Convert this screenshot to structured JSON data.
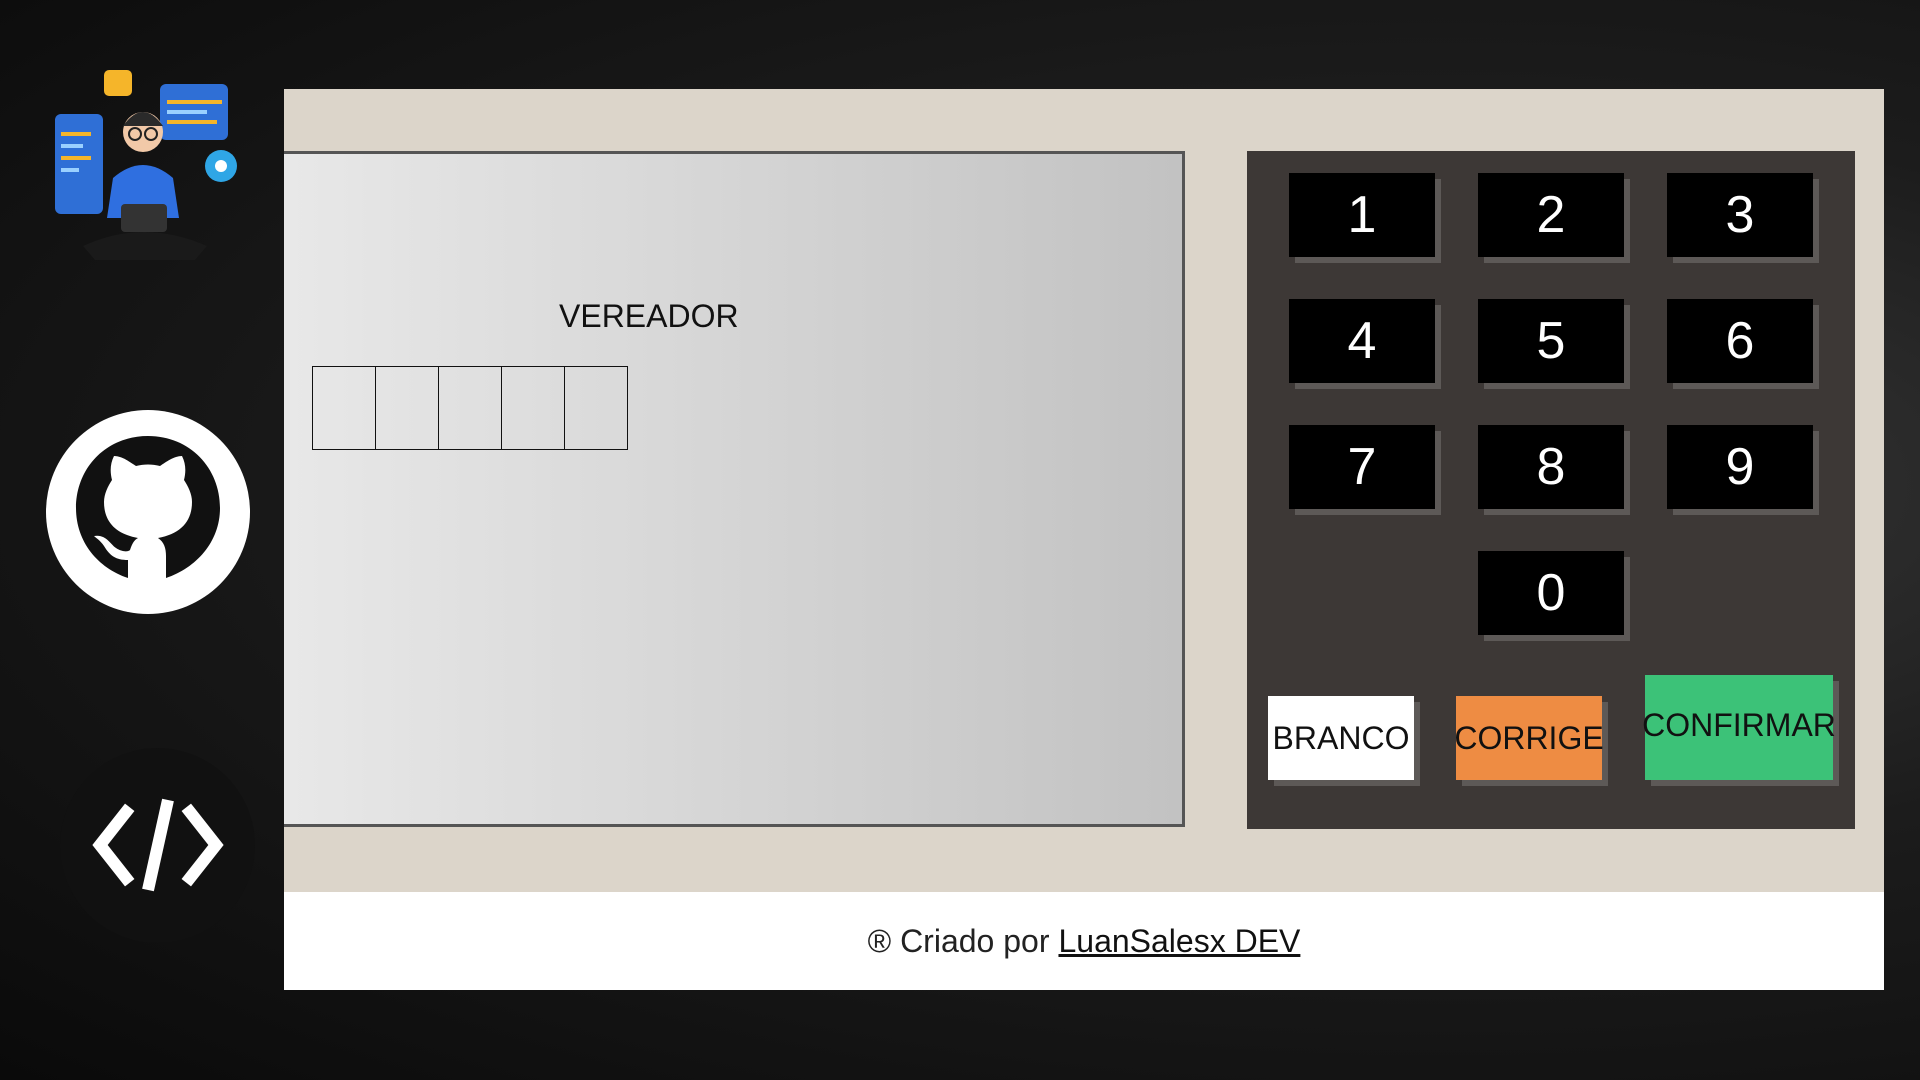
{
  "screen": {
    "office_label": "VEREADOR",
    "digit_boxes": 5
  },
  "keypad": {
    "keys": [
      "1",
      "2",
      "3",
      "4",
      "5",
      "6",
      "7",
      "8",
      "9",
      "0"
    ],
    "blank_label": "BRANCO",
    "correct_label": "CORRIGE",
    "confirm_label": "CONFIRMAR"
  },
  "colors": {
    "panel": "#dcd5ca",
    "keypad": "#3d3836",
    "blank": "#ffffff",
    "correct": "#ee8c43",
    "confirm": "#3cc278"
  },
  "footer": {
    "prefix": "® Criado por",
    "link_text": "LuanSalesx DEV"
  },
  "icons": [
    "developer-illustration-icon",
    "github-icon",
    "code-icon"
  ]
}
